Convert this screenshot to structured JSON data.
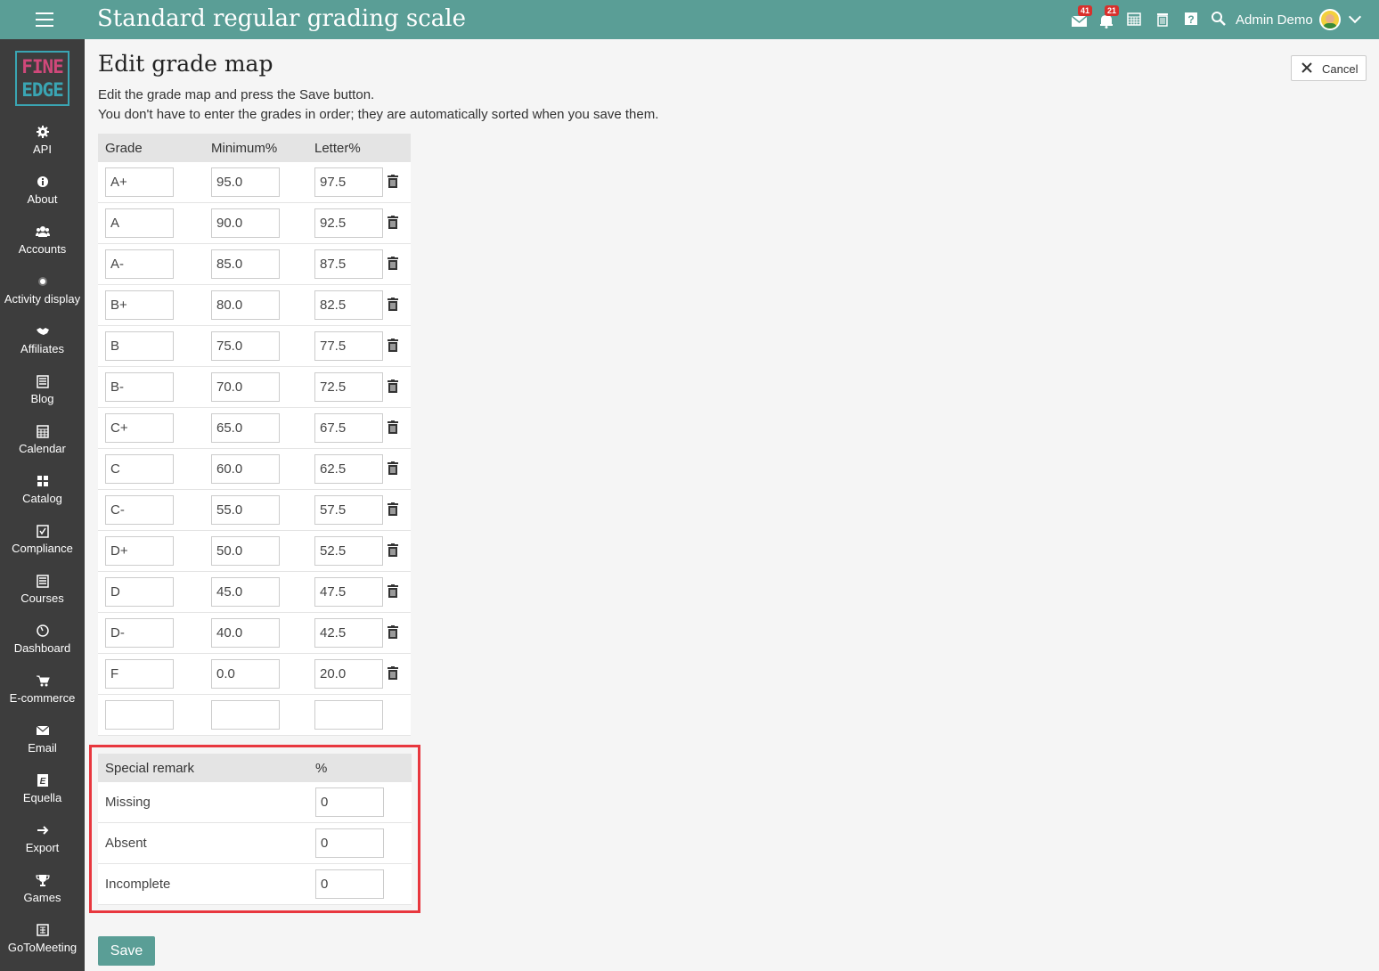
{
  "topbar": {
    "title": "Standard regular grading scale",
    "mail_badge": "41",
    "notif_badge": "21",
    "user_name": "Admin Demo"
  },
  "sidebar": {
    "logo_line1": "FINE",
    "logo_line2": "EDGE",
    "items": [
      {
        "label": "API",
        "icon": "gear-icon"
      },
      {
        "label": "About",
        "icon": "info-icon"
      },
      {
        "label": "Accounts",
        "icon": "users-icon"
      },
      {
        "label": "Activity display",
        "icon": "dot-icon"
      },
      {
        "label": "Affiliates",
        "icon": "handshake-icon"
      },
      {
        "label": "Blog",
        "icon": "blog-icon"
      },
      {
        "label": "Calendar",
        "icon": "calendar-icon"
      },
      {
        "label": "Catalog",
        "icon": "grid-icon"
      },
      {
        "label": "Compliance",
        "icon": "checkbox-icon"
      },
      {
        "label": "Courses",
        "icon": "courses-icon"
      },
      {
        "label": "Dashboard",
        "icon": "gauge-icon"
      },
      {
        "label": "E-commerce",
        "icon": "cart-icon"
      },
      {
        "label": "Email",
        "icon": "envelope-icon"
      },
      {
        "label": "Equella",
        "icon": "equella-icon"
      },
      {
        "label": "Export",
        "icon": "arrow-right-icon"
      },
      {
        "label": "Games",
        "icon": "trophy-icon"
      },
      {
        "label": "GoToMeeting",
        "icon": "meeting-icon"
      }
    ]
  },
  "main": {
    "heading": "Edit grade map",
    "cancel_label": "Cancel",
    "instruction1": "Edit the grade map and press the Save button.",
    "instruction2": "You don't have to enter the grades in order; they are automatically sorted when you save them.",
    "grade_table": {
      "headers": {
        "grade": "Grade",
        "minimum": "Minimum%",
        "letter": "Letter%"
      },
      "rows": [
        {
          "grade": "A+",
          "minimum": "95.0",
          "letter": "97.5"
        },
        {
          "grade": "A",
          "minimum": "90.0",
          "letter": "92.5"
        },
        {
          "grade": "A-",
          "minimum": "85.0",
          "letter": "87.5"
        },
        {
          "grade": "B+",
          "minimum": "80.0",
          "letter": "82.5"
        },
        {
          "grade": "B",
          "minimum": "75.0",
          "letter": "77.5"
        },
        {
          "grade": "B-",
          "minimum": "70.0",
          "letter": "72.5"
        },
        {
          "grade": "C+",
          "minimum": "65.0",
          "letter": "67.5"
        },
        {
          "grade": "C",
          "minimum": "60.0",
          "letter": "62.5"
        },
        {
          "grade": "C-",
          "minimum": "55.0",
          "letter": "57.5"
        },
        {
          "grade": "D+",
          "minimum": "50.0",
          "letter": "52.5"
        },
        {
          "grade": "D",
          "minimum": "45.0",
          "letter": "47.5"
        },
        {
          "grade": "D-",
          "minimum": "40.0",
          "letter": "42.5"
        },
        {
          "grade": "F",
          "minimum": "0.0",
          "letter": "20.0"
        },
        {
          "grade": "",
          "minimum": "",
          "letter": ""
        }
      ]
    },
    "remark_table": {
      "headers": {
        "remark": "Special remark",
        "percent": "%"
      },
      "rows": [
        {
          "label": "Missing",
          "value": "0"
        },
        {
          "label": "Absent",
          "value": "0"
        },
        {
          "label": "Incomplete",
          "value": "0"
        }
      ]
    },
    "save_label": "Save"
  },
  "colors": {
    "topbar": "#5a9e96",
    "sidebar": "#3d3d3d",
    "highlight": "#e8373e",
    "badge": "#d9302c"
  }
}
